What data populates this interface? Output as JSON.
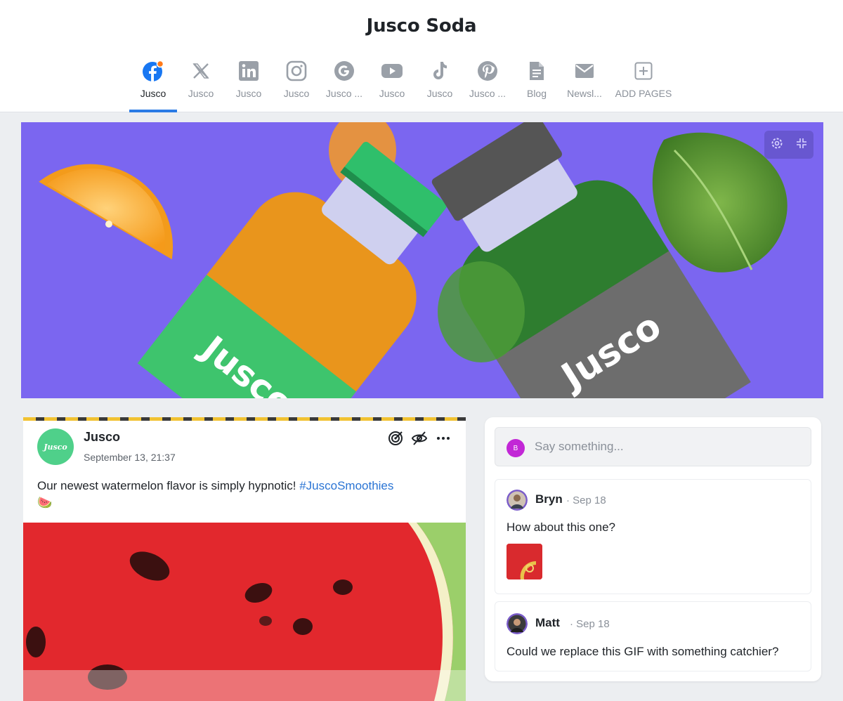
{
  "header": {
    "title": "Jusco Soda"
  },
  "tabs": [
    {
      "label": "Jusco",
      "icon": "facebook-icon",
      "active": true
    },
    {
      "label": "Jusco",
      "icon": "x-icon"
    },
    {
      "label": "Jusco",
      "icon": "linkedin-icon"
    },
    {
      "label": "Jusco",
      "icon": "instagram-icon"
    },
    {
      "label": "Jusco ...",
      "icon": "google-icon"
    },
    {
      "label": "Jusco",
      "icon": "youtube-icon"
    },
    {
      "label": "Jusco",
      "icon": "tiktok-icon"
    },
    {
      "label": "Jusco ...",
      "icon": "pinterest-icon"
    },
    {
      "label": "Blog",
      "icon": "document-icon"
    },
    {
      "label": "Newsl...",
      "icon": "mail-icon"
    },
    {
      "label": "ADD PAGES",
      "icon": "add-icon"
    }
  ],
  "cover": {
    "bottle_left_label": "Jusco",
    "bottle_right_label": "Jusco",
    "controls": [
      "gear-icon",
      "collapse-icon"
    ]
  },
  "post": {
    "avatar_text": "Jusco",
    "author": "Jusco",
    "date": "September 13, 21:37",
    "text": "Our newest watermelon flavor is simply hypnotic! ",
    "hashtag": "#JuscoSmoothies",
    "emoji": "🍉",
    "actions": [
      "target-icon",
      "eye-off-icon",
      "more-icon"
    ]
  },
  "comments": {
    "composer": {
      "avatar": "B",
      "placeholder": "Say something..."
    },
    "items": [
      {
        "author": "Bryn",
        "date": "· Sep 18",
        "text": "How about this one?"
      },
      {
        "author": "Matt",
        "date": "· Sep 18",
        "text": "Could we replace this GIF with something catchier?"
      }
    ]
  },
  "colors": {
    "accent": "#2b7be5",
    "cover_bg": "#7b66f0",
    "hashtag": "#2a74d4",
    "composer_avatar": "#c227d6"
  }
}
